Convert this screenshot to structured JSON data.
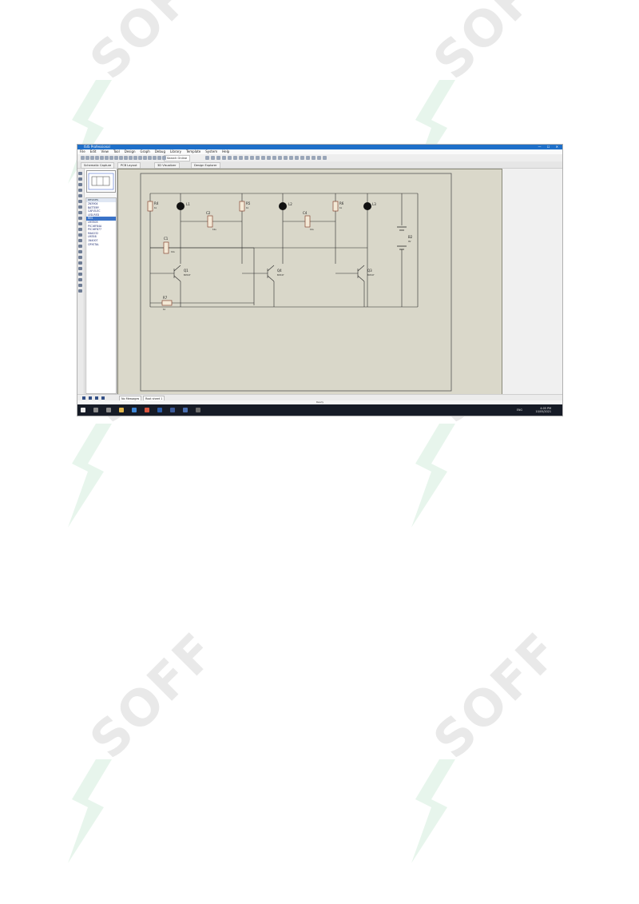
{
  "watermark": {
    "text": "SOFF"
  },
  "window": {
    "title": "ISIS Professional",
    "menu": [
      "File",
      "Edit",
      "View",
      "Tool",
      "Design",
      "Graph",
      "Debug",
      "Library",
      "Template",
      "System",
      "Help"
    ]
  },
  "tabs": {
    "items": [
      "Schematic Capture",
      "PCB Layout",
      "3D Visualizer",
      "Design Explorer"
    ]
  },
  "search": {
    "placeholder": "Search Online"
  },
  "sidebar": {
    "header": "DEVICES",
    "devices": [
      "2N3904",
      "BATTERY",
      "CAP-ELEC",
      "LED-RED",
      "RES",
      "LM7805",
      "PIC16F84A",
      "PIC16F877",
      "MAX232",
      "LM358",
      "1N4007",
      "CRYSTAL"
    ],
    "selected_index": 4
  },
  "schematic": {
    "labels": {
      "R4": "R4",
      "R4v": "1k",
      "R5": "R5",
      "R5v": "1k",
      "R6": "R6",
      "R6v": "1k",
      "R7": "R7",
      "R7v": "1k",
      "L1": "L1",
      "L2": "L2",
      "L3": "L3",
      "C1": "C1",
      "C1v": "10u",
      "C2": "C2",
      "C2v": "10u",
      "C4": "C4",
      "C4v": "10u",
      "Q1": "Q1",
      "Q1v": "BC547",
      "Q4": "Q4",
      "Q4v": "BC547",
      "Q3": "Q3",
      "Q3v": "BC547",
      "B2": "B2",
      "B2v": "9V"
    }
  },
  "simulation": {
    "status": "No Messages",
    "state": "Root sheet 1"
  },
  "statusbar": {
    "text": "Ready"
  },
  "taskbar": {
    "time": "4:05 PM",
    "date": "10/05/2021",
    "lang": "ENG"
  }
}
